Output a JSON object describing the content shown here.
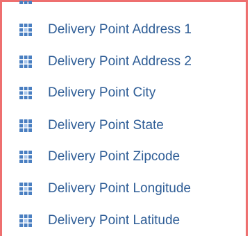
{
  "field_list": {
    "icon": "table-grid-icon",
    "accent_color": "#2e5d96",
    "border_color": "#ee6f6f",
    "items": [
      {
        "label": "Delivery Point Address 1"
      },
      {
        "label": "Delivery Point Address 2"
      },
      {
        "label": "Delivery Point City"
      },
      {
        "label": "Delivery Point State"
      },
      {
        "label": "Delivery Point Zipcode"
      },
      {
        "label": "Delivery Point Longitude"
      },
      {
        "label": "Delivery Point Latitude"
      }
    ]
  }
}
